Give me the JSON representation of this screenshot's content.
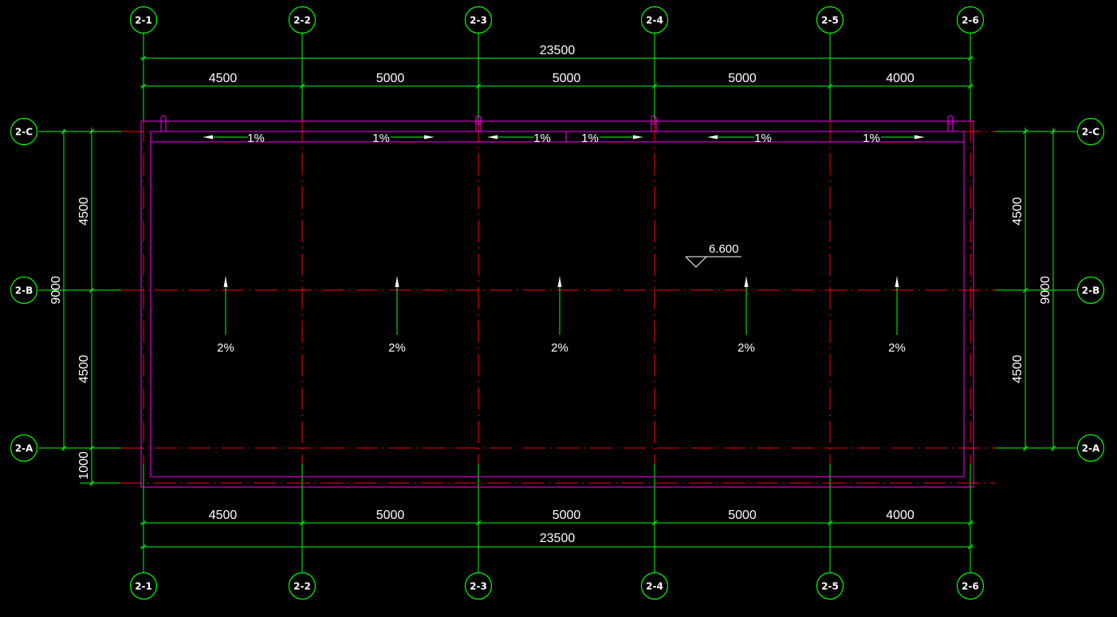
{
  "colors": {
    "background": "#000000",
    "grid_axis": "#00FF00",
    "dimension": "#00FF00",
    "centerline": "#FF0000",
    "outline": "#FF00FF",
    "text": "#FFFFFF"
  },
  "axes": {
    "columns": [
      "2-1",
      "2-2",
      "2-3",
      "2-4",
      "2-5",
      "2-6"
    ],
    "rows": [
      "2-C",
      "2-B",
      "2-A"
    ]
  },
  "dimensions": {
    "top_total": "23500",
    "top_spans": [
      "4500",
      "5000",
      "5000",
      "5000",
      "4000"
    ],
    "bottom_spans": [
      "4500",
      "5000",
      "5000",
      "5000",
      "4000"
    ],
    "bottom_total": "23500",
    "left_spans": [
      "4500",
      "4500"
    ],
    "left_total": "9000",
    "left_extra": "1000",
    "right_spans": [
      "4500",
      "4500"
    ],
    "right_total": "9000"
  },
  "slopes": {
    "gutter": [
      "1%",
      "1%",
      "1%",
      "1%",
      "1%",
      "1%"
    ],
    "roof": [
      "2%",
      "2%",
      "2%",
      "2%",
      "2%"
    ]
  },
  "elevation": "6.600"
}
